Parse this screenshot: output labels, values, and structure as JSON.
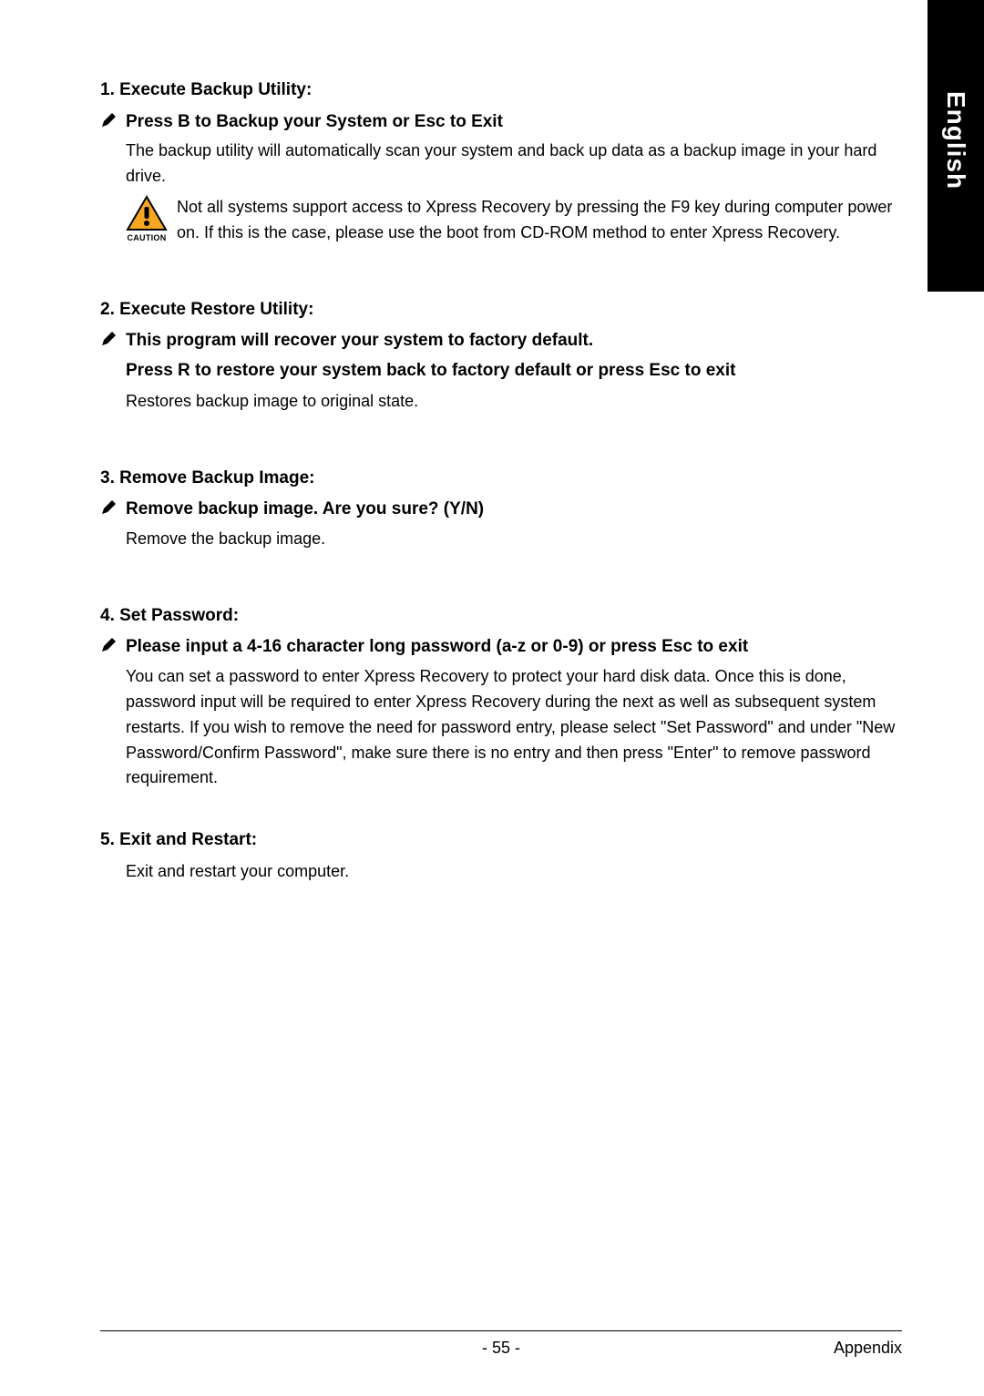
{
  "sidebar": {
    "label": "English"
  },
  "sections": {
    "s1": {
      "title": "1. Execute Backup Utility:",
      "bullet": "Press B to Backup your System or Esc to Exit",
      "body": "The backup utility will automatically scan your system and back up data as a backup image in your hard drive.",
      "caution_label": "CAUTION",
      "caution_text": "Not all systems support access to Xpress Recovery by pressing the F9 key during computer power on. If this is the case, please use the boot from CD-ROM method to enter Xpress Recovery."
    },
    "s2": {
      "title": "2. Execute Restore Utility:",
      "bullet": "This program will recover your system to factory default.",
      "sub_bold": "Press R to restore your system back to factory default or press Esc to exit",
      "body": "Restores backup image to original state."
    },
    "s3": {
      "title": "3. Remove Backup Image:",
      "bullet": "Remove backup image.  Are you sure?  (Y/N)",
      "body": "Remove the backup image."
    },
    "s4": {
      "title": "4. Set Password:",
      "bullet": "Please input a 4-16 character long password (a-z or 0-9) or press Esc to exit",
      "body": "You can set a password to enter Xpress Recovery to protect your hard disk data.  Once this is done, password input will be required to enter Xpress Recovery during the next as well as subsequent system restarts.  If you wish to remove the need for password entry, please select \"Set Password\" and under \"New Password/Confirm Password\", make sure there is no entry and then press \"Enter\" to remove password requirement."
    },
    "s5": {
      "title": "5. Exit and Restart:",
      "body": "Exit and restart your computer."
    }
  },
  "footer": {
    "page": "- 55 -",
    "section": "Appendix"
  }
}
